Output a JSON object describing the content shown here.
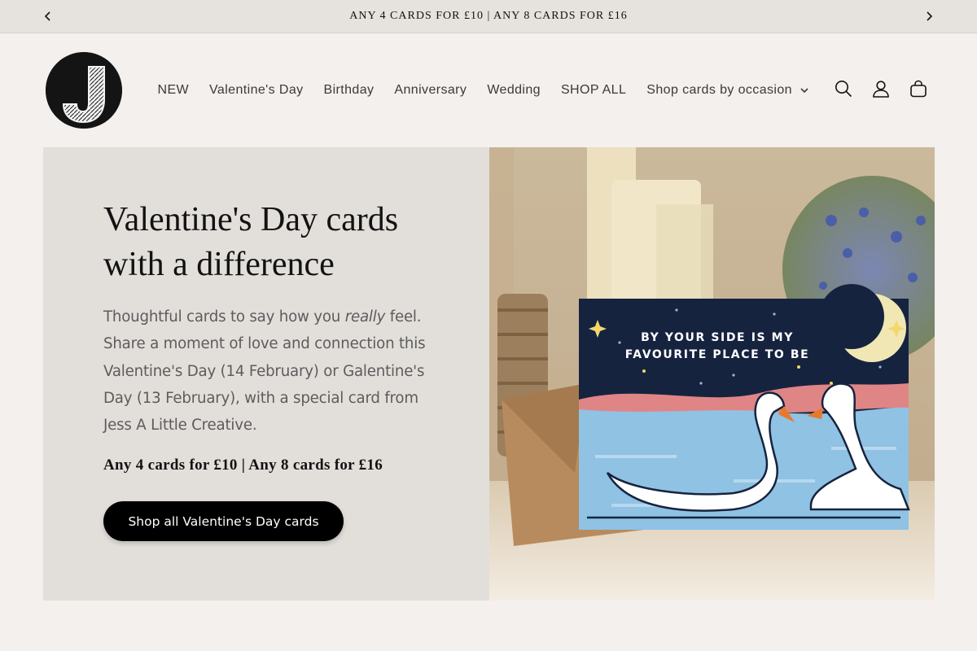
{
  "announcement": {
    "text": "ANY 4 CARDS FOR £10 | ANY 8 CARDS FOR £16",
    "prev_icon": "chevron-left-icon",
    "next_icon": "chevron-right-icon"
  },
  "header": {
    "logo_letter": "J",
    "nav": [
      {
        "label": "NEW"
      },
      {
        "label": "Valentine's Day"
      },
      {
        "label": "Birthday"
      },
      {
        "label": "Anniversary"
      },
      {
        "label": "Wedding"
      },
      {
        "label": "SHOP ALL"
      },
      {
        "label": "Shop cards by occasion",
        "icon": "chevron-down-icon"
      }
    ],
    "icons": [
      "search-icon",
      "account-icon",
      "cart-icon"
    ]
  },
  "banner": {
    "heading": "Valentine's Day cards with a difference",
    "body_before": "Thoughtful cards to say how you ",
    "body_emphasis": "really",
    "body_after": " feel. Share a moment of love and connection this Valentine's Day (14 February) or Galentine's Day (13 February), with a special card from Jess A Little Creative.",
    "offer": "Any 4 cards for £10 | Any 8 cards for £16",
    "button_label": "Shop all Valentine's Day cards",
    "card_text_line1": "BY YOUR SIDE IS MY",
    "card_text_line2": "FAVOURITE PLACE TO BE"
  },
  "colors": {
    "page_bg": "#f3f0ed",
    "announcement_bg": "#e6e2de",
    "banner_text_bg": "#e2dfdb",
    "button_bg": "#000000",
    "card_night": "#16233f",
    "card_water": "#8fc2e3",
    "card_horizon": "#e08586"
  }
}
